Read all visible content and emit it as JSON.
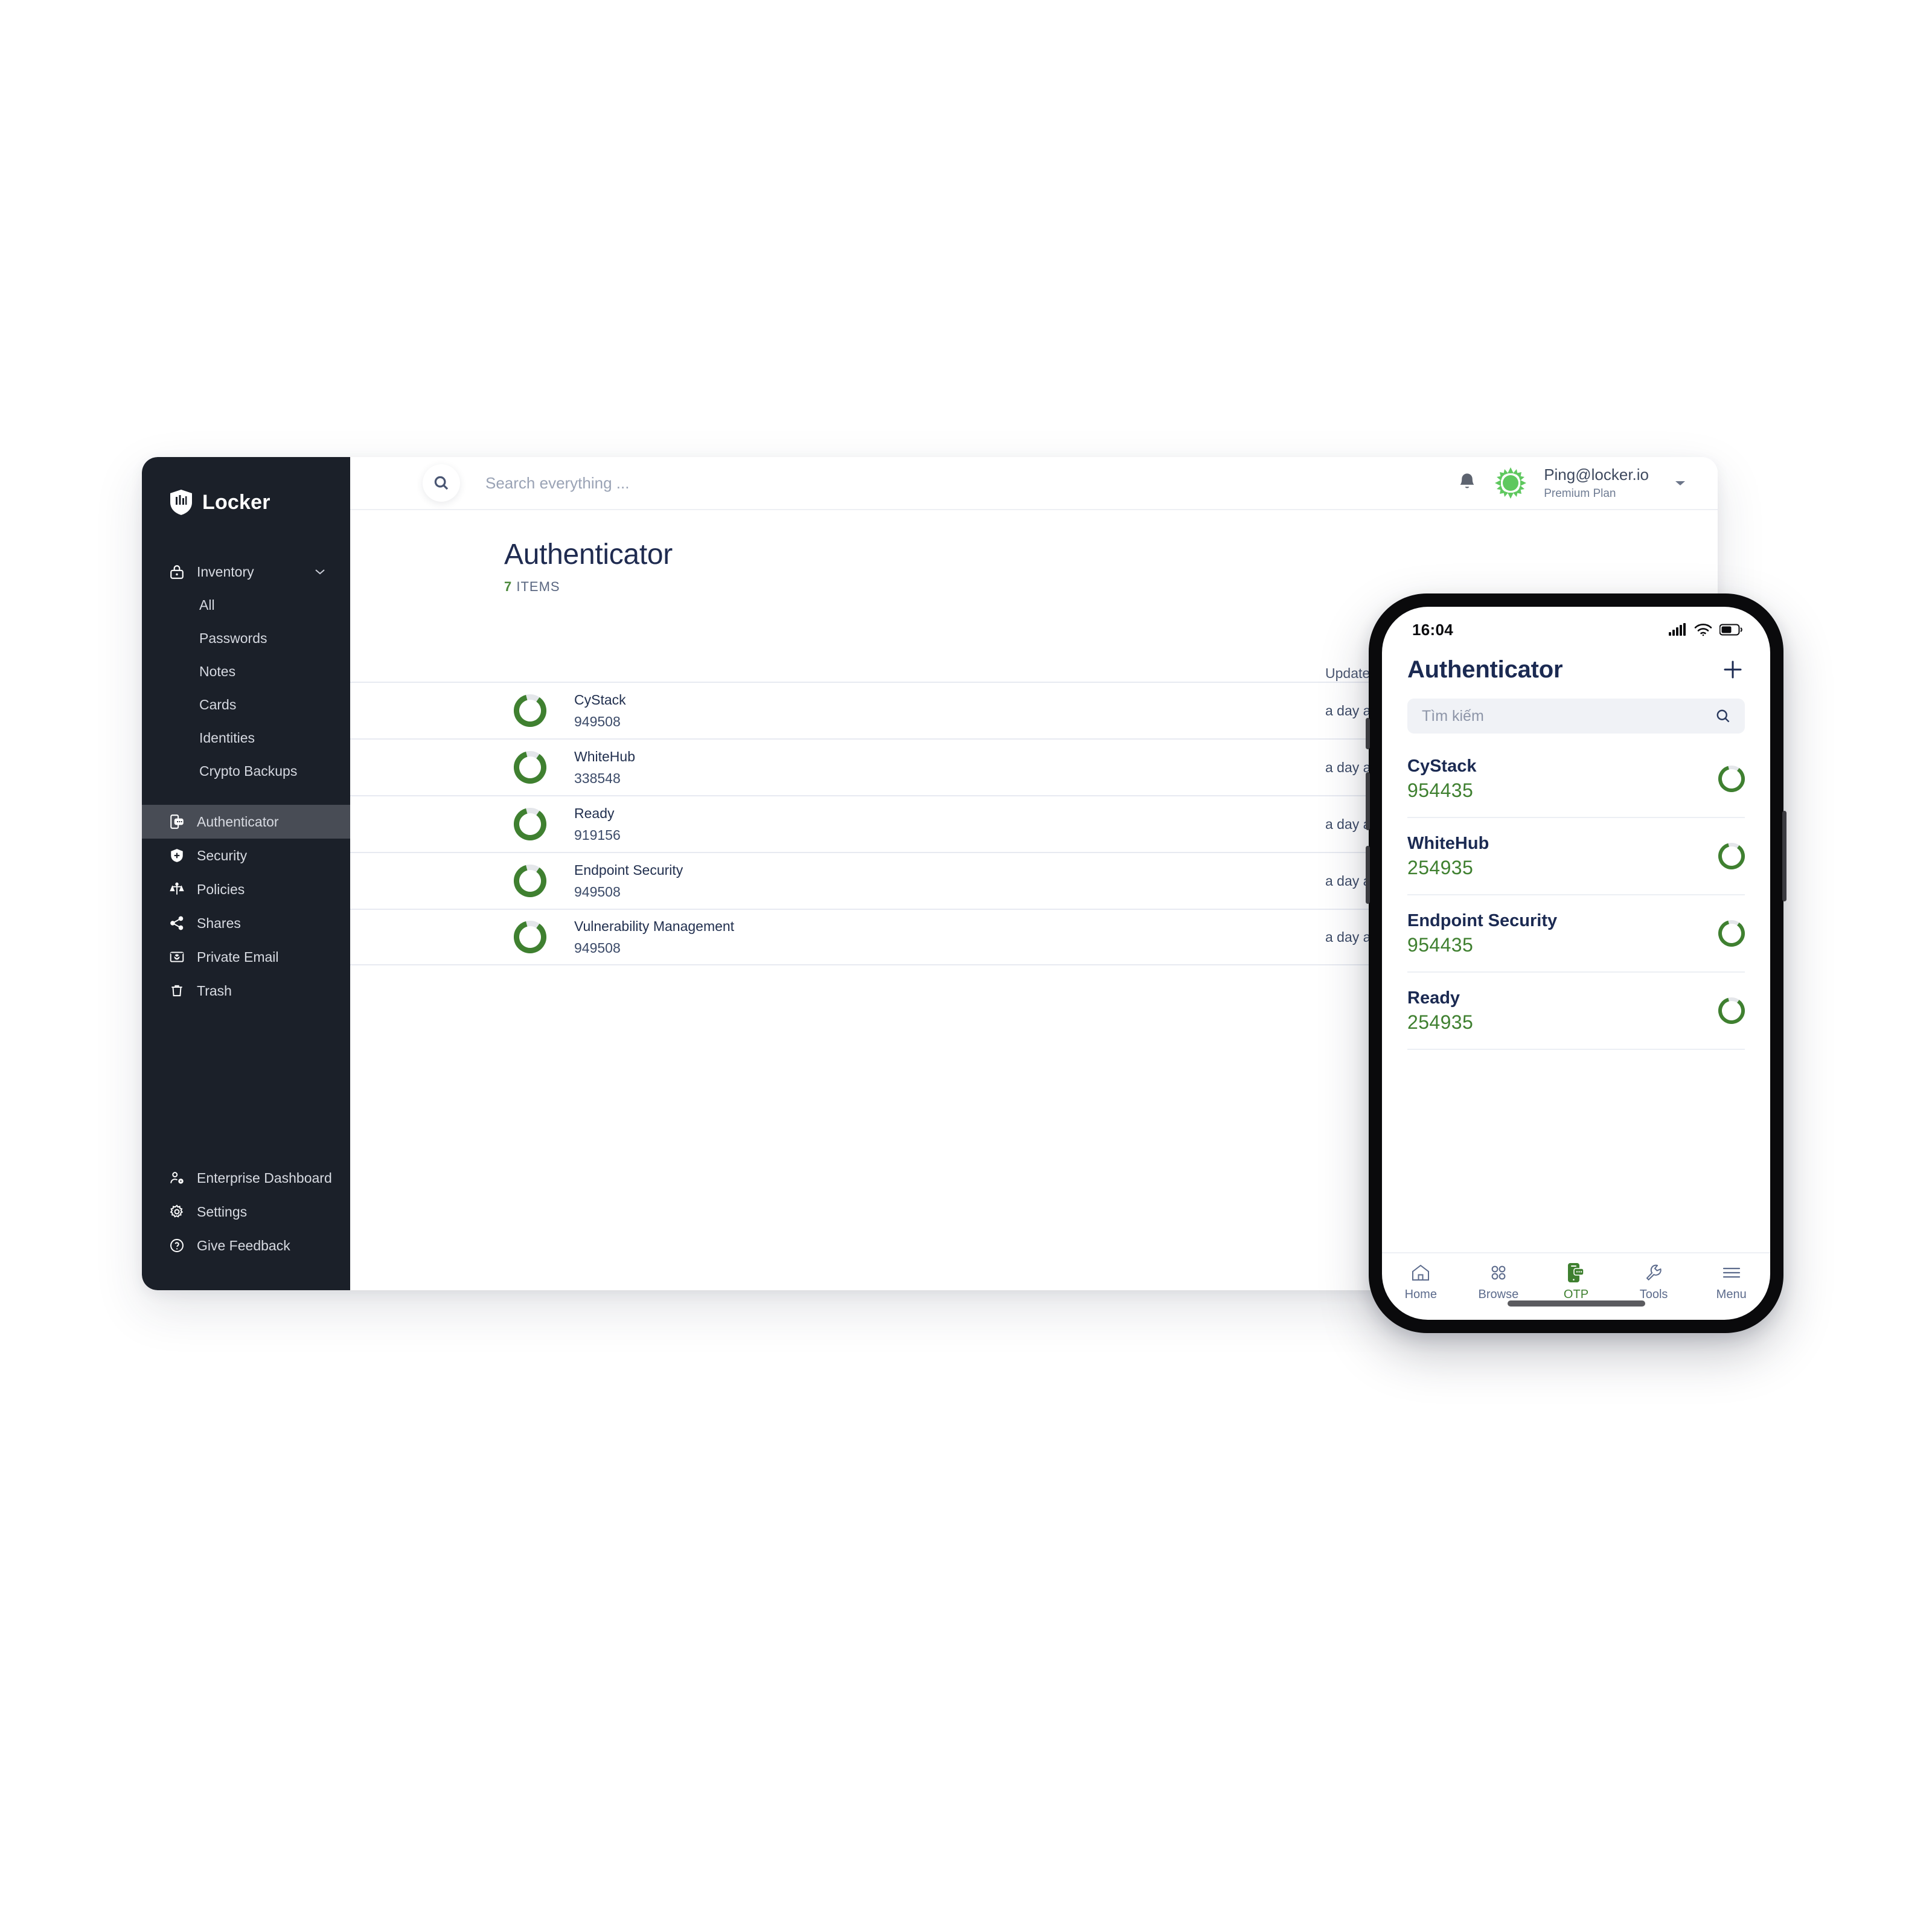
{
  "colors": {
    "sidebar_bg": "#1b2029",
    "sidebar_active": "#484c55",
    "accent_green": "#3f8030",
    "navy": "#1b2a52",
    "phone_frame": "#0a0a0c"
  },
  "desktop": {
    "brand": {
      "name": "Locker",
      "logo_icon": "shield-bars-logo"
    },
    "sidebar": {
      "inventory": {
        "label": "Inventory",
        "icon": "lock-icon",
        "chevron": "chevron-down-icon"
      },
      "inventory_children": [
        {
          "label": "All"
        },
        {
          "label": "Passwords"
        },
        {
          "label": "Notes"
        },
        {
          "label": "Cards"
        },
        {
          "label": "Identities"
        },
        {
          "label": "Crypto Backups"
        }
      ],
      "sections": [
        {
          "label": "Authenticator",
          "icon": "authenticator-icon",
          "active": true
        },
        {
          "label": "Security",
          "icon": "shield-icon",
          "active": false
        },
        {
          "label": "Policies",
          "icon": "scales-icon",
          "active": false
        },
        {
          "label": "Shares",
          "icon": "share-icon",
          "active": false
        },
        {
          "label": "Private Email",
          "icon": "envelope-icon",
          "active": false
        },
        {
          "label": "Trash",
          "icon": "trash-icon",
          "active": false
        }
      ],
      "bottom": [
        {
          "label": "Enterprise Dashboard",
          "icon": "user-gear-icon"
        },
        {
          "label": "Settings",
          "icon": "gear-icon"
        },
        {
          "label": "Give Feedback",
          "icon": "question-circle-icon"
        }
      ]
    },
    "topbar": {
      "search_placeholder": "Search everything ...",
      "search_value": "",
      "search_icon": "search-icon",
      "bell_icon": "bell-icon",
      "avatar_icon": "avatar-identicon",
      "account_email": "Ping@locker.io",
      "account_plan": "Premium Plan",
      "caret_icon": "chevron-down-icon"
    },
    "content": {
      "title": "Authenticator",
      "count": "7",
      "count_suffix": " ITEMS",
      "col_name": "",
      "col_updated": "Updated time",
      "rows": [
        {
          "name": "CyStack",
          "code": "949508",
          "updated": "a day ago"
        },
        {
          "name": "WhiteHub",
          "code": "338548",
          "updated": "a day ago"
        },
        {
          "name": "Ready",
          "code": "919156",
          "updated": "a day ago"
        },
        {
          "name": "Endpoint Security",
          "code": "949508",
          "updated": "a day ago"
        },
        {
          "name": "Vulnerability Management",
          "code": "949508",
          "updated": "a day ago"
        }
      ]
    }
  },
  "phone": {
    "status": {
      "time": "16:04",
      "cellular_icon": "cellular-bars-icon",
      "wifi_icon": "wifi-icon",
      "battery_icon": "battery-icon"
    },
    "header": {
      "title": "Authenticator",
      "add_icon": "plus-icon"
    },
    "search": {
      "placeholder": "Tìm kiếm",
      "value": "",
      "icon": "search-icon"
    },
    "items": [
      {
        "name": "CyStack",
        "code": "954435"
      },
      {
        "name": "WhiteHub",
        "code": "254935"
      },
      {
        "name": "Endpoint Security",
        "code": "954435"
      },
      {
        "name": "Ready",
        "code": "254935"
      }
    ],
    "tabs": [
      {
        "label": "Home",
        "icon": "home-icon",
        "active": false
      },
      {
        "label": "Browse",
        "icon": "grid-dots-icon",
        "active": false
      },
      {
        "label": "OTP",
        "icon": "otp-phone-icon",
        "active": true
      },
      {
        "label": "Tools",
        "icon": "wrench-icon",
        "active": false
      },
      {
        "label": "Menu",
        "icon": "hamburger-icon",
        "active": false
      }
    ]
  },
  "background": {
    "watermark": ""
  }
}
